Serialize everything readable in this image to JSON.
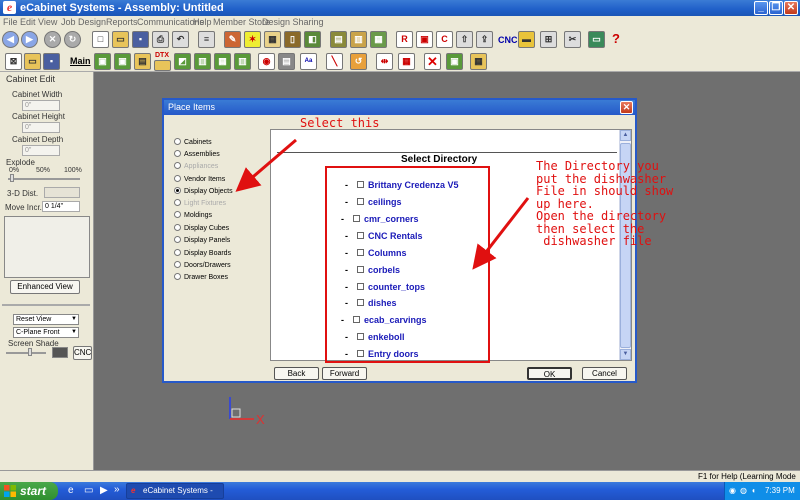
{
  "window": {
    "title": "eCabinet Systems - Assembly: Untitled",
    "icon": "ecabinet-logo-icon",
    "controls": [
      "_",
      "❐",
      "✕"
    ]
  },
  "menu": [
    "File",
    "Edit",
    "View",
    "Job",
    "Design",
    "Reports",
    "Communications",
    "Help",
    "Member Store",
    "Design Sharing"
  ],
  "toolbar": {
    "cnc_label": "CNC",
    "help_label": "?"
  },
  "toolbar2": {
    "main_label": "Main",
    "dtx_label": "DTX"
  },
  "left_panel": {
    "title": "Cabinet Edit",
    "cabinet_width_label": "Cabinet Width",
    "cabinet_width_value": "0\"",
    "cabinet_height_label": "Cabinet Height",
    "cabinet_height_value": "0\"",
    "cabinet_depth_label": "Cabinet Depth",
    "cabinet_depth_value": "0\"",
    "explode_label": "Explode",
    "explode_ticks": [
      "0%",
      "50%",
      "100%"
    ],
    "dist_label": "3-D Dist.",
    "move_incr_label": "Move Incr.",
    "move_incr_value": "0 1/4\"",
    "enhanced_view_label": "Enhanced View",
    "reset_view_value": "Reset View",
    "plane_value": "C-Plane Front",
    "screen_shade_label": "Screen Shade",
    "cnc_label": "CNC"
  },
  "dialog": {
    "title": "Place Items",
    "close": "✕",
    "options": [
      {
        "label": "Cabinets",
        "selected": false,
        "enabled": true
      },
      {
        "label": "Assemblies",
        "selected": false,
        "enabled": true
      },
      {
        "label": "Appliances",
        "selected": false,
        "enabled": false
      },
      {
        "label": "Vendor Items",
        "selected": false,
        "enabled": true
      },
      {
        "label": "Display Objects",
        "selected": true,
        "enabled": true
      },
      {
        "label": "Light Fixtures",
        "selected": false,
        "enabled": false
      },
      {
        "label": "Moldings",
        "selected": false,
        "enabled": true
      },
      {
        "label": "Display Cubes",
        "selected": false,
        "enabled": true
      },
      {
        "label": "Display Panels",
        "selected": false,
        "enabled": true
      },
      {
        "label": "Display Boards",
        "selected": false,
        "enabled": true
      },
      {
        "label": "Doors/Drawers",
        "selected": false,
        "enabled": true
      },
      {
        "label": "Drawer Boxes",
        "selected": false,
        "enabled": true
      }
    ],
    "directory_title": "Select Directory",
    "directories": [
      "Brittany Credenza V5",
      "ceilings",
      "cmr_corners",
      "CNC Rentals",
      "Columns",
      "corbels",
      "counter_tops",
      "dishes",
      "ecab_carvings",
      "enkeboll",
      "Entry doors"
    ],
    "buttons": {
      "back": "Back",
      "forward": "Forward",
      "ok": "OK",
      "cancel": "Cancel"
    }
  },
  "annotations": {
    "select_this": "Select this",
    "note_lines": [
      "The Directory you",
      "put the dishwasher",
      "File in should show",
      "up here.",
      "Open the directory",
      "then select the",
      " dishwasher file"
    ],
    "color": "#e01010"
  },
  "axis_label": "X",
  "status": {
    "help": "F1 for Help (Learning Mode OFF)"
  },
  "taskbar": {
    "start": "start",
    "task": "eCabinet Systems - A...",
    "time": "7:39 PM"
  }
}
